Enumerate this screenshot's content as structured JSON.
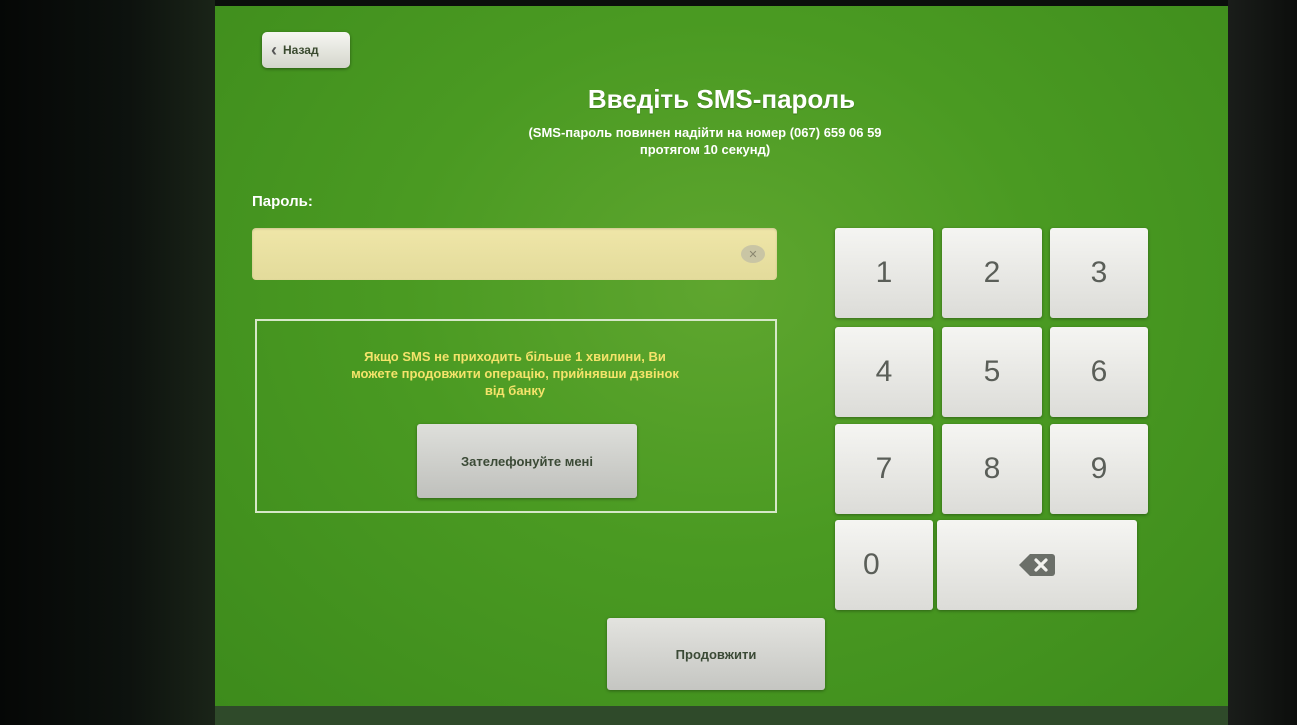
{
  "back_button": {
    "label": "Назад"
  },
  "title": "Введіть SMS-пароль",
  "subtitle_line1": "(SMS-пароль повинен надійти на номер (067) 659 06 59",
  "subtitle_line2": "протягом 10 секунд)",
  "password": {
    "label": "Пароль:",
    "value": "",
    "clear_icon": "✕"
  },
  "info": {
    "line1": "Якщо SMS не приходить більше 1 хвилини, Ви",
    "line2": "можете продовжити операцію, прийнявши дзвінок",
    "line3": "від банку",
    "call_button": "Зателефонуйте мені"
  },
  "keypad": {
    "keys": [
      "1",
      "2",
      "3",
      "4",
      "5",
      "6",
      "7",
      "8",
      "9",
      "0"
    ],
    "backspace_icon": "backspace-icon"
  },
  "continue_button": "Продовжити",
  "colors": {
    "screen_green": "#4a9a22",
    "input_yellow": "#efe6a8",
    "info_text": "#f4e36a",
    "key_gray": "#e8e8e4"
  }
}
